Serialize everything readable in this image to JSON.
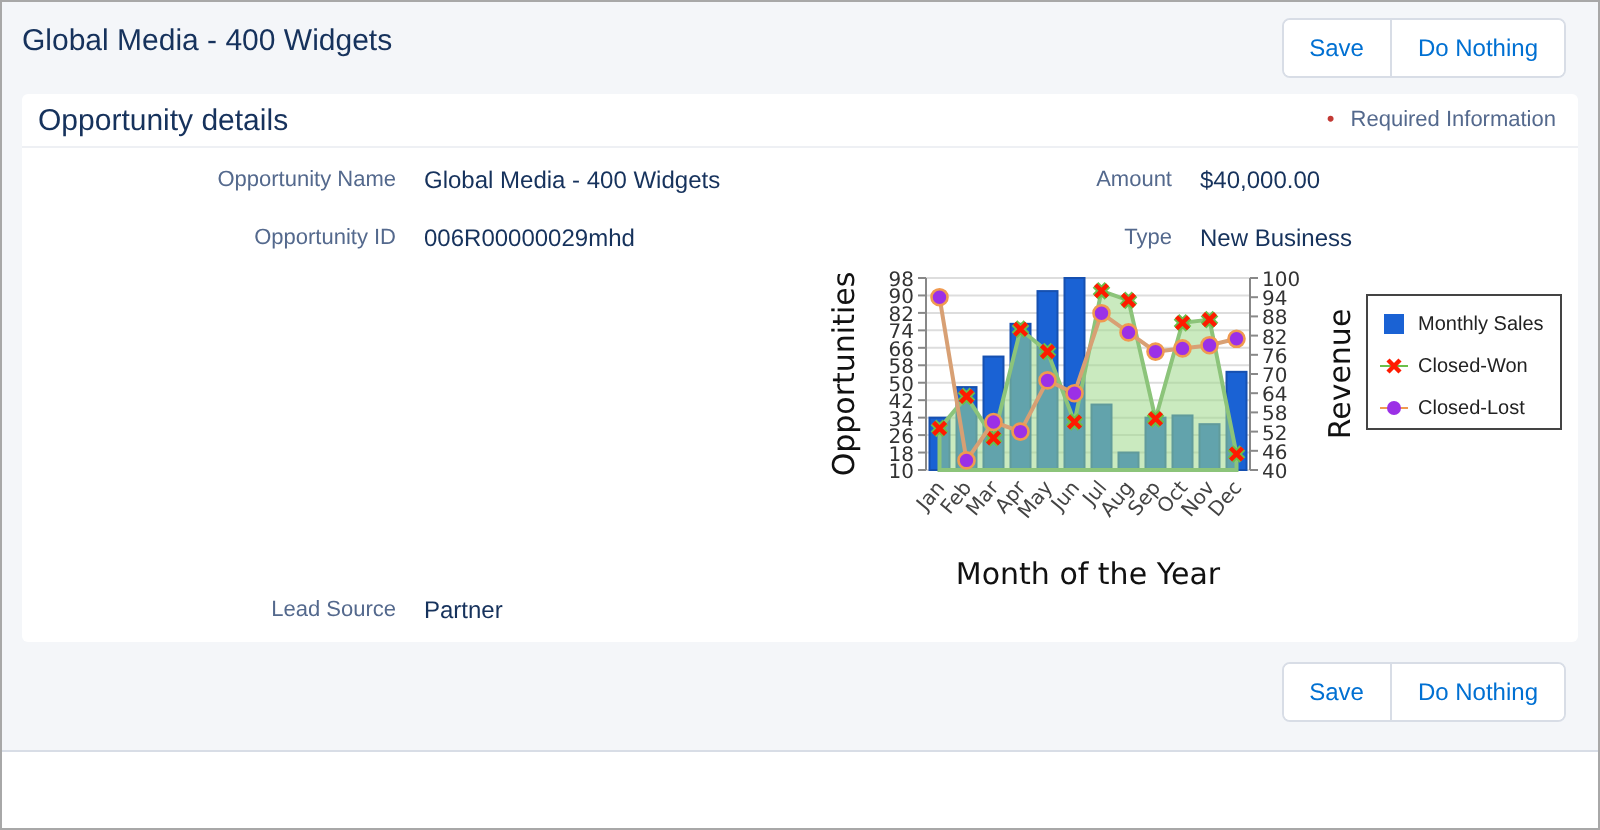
{
  "header": {
    "title": "Global Media - 400 Widgets",
    "buttons": [
      "Save",
      "Do Nothing"
    ]
  },
  "card": {
    "title": "Opportunity details",
    "required_mark": "•",
    "required_text": "Required Information",
    "fields": [
      {
        "label": "Opportunity Name",
        "value": "Global Media - 400 Widgets"
      },
      {
        "label": "Amount",
        "value": "$40,000.00"
      },
      {
        "label": "Opportunity ID",
        "value": "006R00000029mhd"
      },
      {
        "label": "Type",
        "value": "New Business"
      }
    ],
    "chart_data": {
      "type": "bar",
      "xlabel": "Month of the Year",
      "ylabel": "Opportunities",
      "y2label": "Revenue",
      "stacked": false,
      "grid": true,
      "legend": "right",
      "categories": [
        "Jan",
        "Feb",
        "Mar",
        "Apr",
        "May",
        "Jun",
        "Jul",
        "Aug",
        "Sep",
        "Oct",
        "Nov",
        "Dec"
      ],
      "ylim": [
        10,
        98
      ],
      "y2lim": [
        40,
        100
      ],
      "yticks": [
        10,
        18,
        26,
        34,
        42,
        50,
        58,
        66,
        74,
        82,
        90,
        98
      ],
      "y2ticks": [
        40,
        46,
        52,
        58,
        64,
        70,
        76,
        82,
        88,
        94,
        100
      ],
      "series": [
        {
          "name": "Monthly Sales",
          "color": "#1a62d4",
          "values": [
            34,
            48,
            62,
            77,
            92,
            98,
            40,
            18,
            34,
            35,
            31,
            55
          ]
        },
        {
          "name": "Closed-Won",
          "type": "area",
          "axis": "y2",
          "marker": "x",
          "color": "#ff1a00",
          "values": [
            53,
            63,
            50,
            84,
            77,
            55,
            96,
            93,
            56,
            86,
            87,
            45
          ]
        },
        {
          "name": "Closed-Lost",
          "type": "line",
          "axis": "y2",
          "marker": "circle",
          "color": "#9b30e6",
          "values": [
            94,
            43,
            55,
            52,
            68,
            64,
            89,
            83,
            77,
            78,
            79,
            81
          ]
        }
      ]
    },
    "lead_source": {
      "label": "Lead Source",
      "value": "Partner"
    }
  },
  "footer": {
    "buttons": [
      "Save",
      "Do Nothing"
    ]
  }
}
